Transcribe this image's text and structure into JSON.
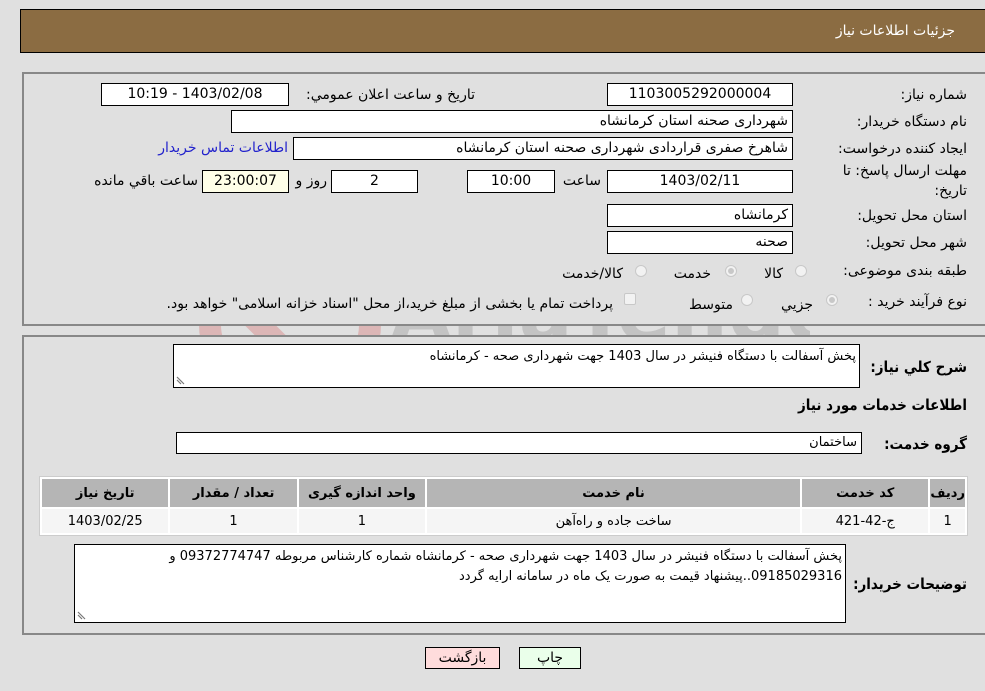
{
  "header": {
    "title": "جزئیات اطلاعات نیاز"
  },
  "form": {
    "need_number_label": "شماره نیاز:",
    "need_number": "1103005292000004",
    "announce_label": "تاریخ و ساعت اعلان عمومي:",
    "announce_value": "1403/02/08 - 10:19",
    "buyer_org_label": "نام دستگاه خریدار:",
    "buyer_org": "شهرداری صحنه استان کرمانشاه",
    "creator_label": "ایجاد کننده درخواست:",
    "creator": "شاهرخ صفری قراردادی شهرداری صحنه استان کرمانشاه",
    "contact_link": "اطلاعات تماس خریدار",
    "deadline_label_line1": "مهلت ارسال پاسخ: تا",
    "deadline_label_line2": "تاریخ:",
    "deadline_date": "1403/02/11",
    "time_label": "ساعت",
    "deadline_time": "10:00",
    "days_value": "2",
    "days_label": "روز و",
    "remaining_time": "23:00:07",
    "remaining_label": "ساعت باقي مانده",
    "province_label": "استان محل تحویل:",
    "province": "کرمانشاه",
    "city_label": "شهر محل تحویل:",
    "city": "صحنه",
    "category_label": "طبقه بندی موضوعی:",
    "category_options": [
      {
        "label": "کالا",
        "checked": false
      },
      {
        "label": "خدمت",
        "checked": true
      },
      {
        "label": "کالا/خدمت",
        "checked": false
      }
    ],
    "process_label": "نوع فرآیند خرید :",
    "process_options": [
      {
        "label": "جزیي",
        "checked": true
      },
      {
        "label": "متوسط",
        "checked": false
      }
    ],
    "treasury_note": "پرداخت تمام یا بخشی از مبلغ خرید،از محل \"اسناد خزانه اسلامی\" خواهد بود.",
    "treasury_checked": false
  },
  "details": {
    "summary_label": "شرح كلي نياز:",
    "summary": "پخش آسفالت با دستگاه فنیشر در سال 1403 جهت شهرداری صحه - کرمانشاه",
    "services_heading": "اطلاعات خدمات مورد نیاز",
    "service_group_label": "گروه خدمت:",
    "service_group": "ساختمان",
    "table": {
      "headers": [
        "ردیف",
        "کد خدمت",
        "نام خدمت",
        "واحد اندازه گیری",
        "تعداد / مقدار",
        "تاریخ نیاز"
      ],
      "rows": [
        [
          "1",
          "ج-42-421",
          "ساخت جاده و راه‌آهن",
          "1",
          "1",
          "1403/02/25"
        ]
      ]
    },
    "buyer_notes_label": "توضیحات خریدار:",
    "buyer_notes": "پخش آسفالت با دستگاه فنیشر در سال 1403 جهت شهرداری صحه - کرمانشاه  شماره کارشناس مربوطه 09372774747 و 09185029316..پیشنهاد قیمت به صورت یک ماه در سامانه ارایه گردد"
  },
  "buttons": {
    "print": "چاپ",
    "back": "بازگشت"
  },
  "colors": {
    "header_bg": "#8b6c42",
    "print_bg": "#eaffea",
    "back_bg": "#ffdcdc",
    "link": "#2222cc"
  }
}
